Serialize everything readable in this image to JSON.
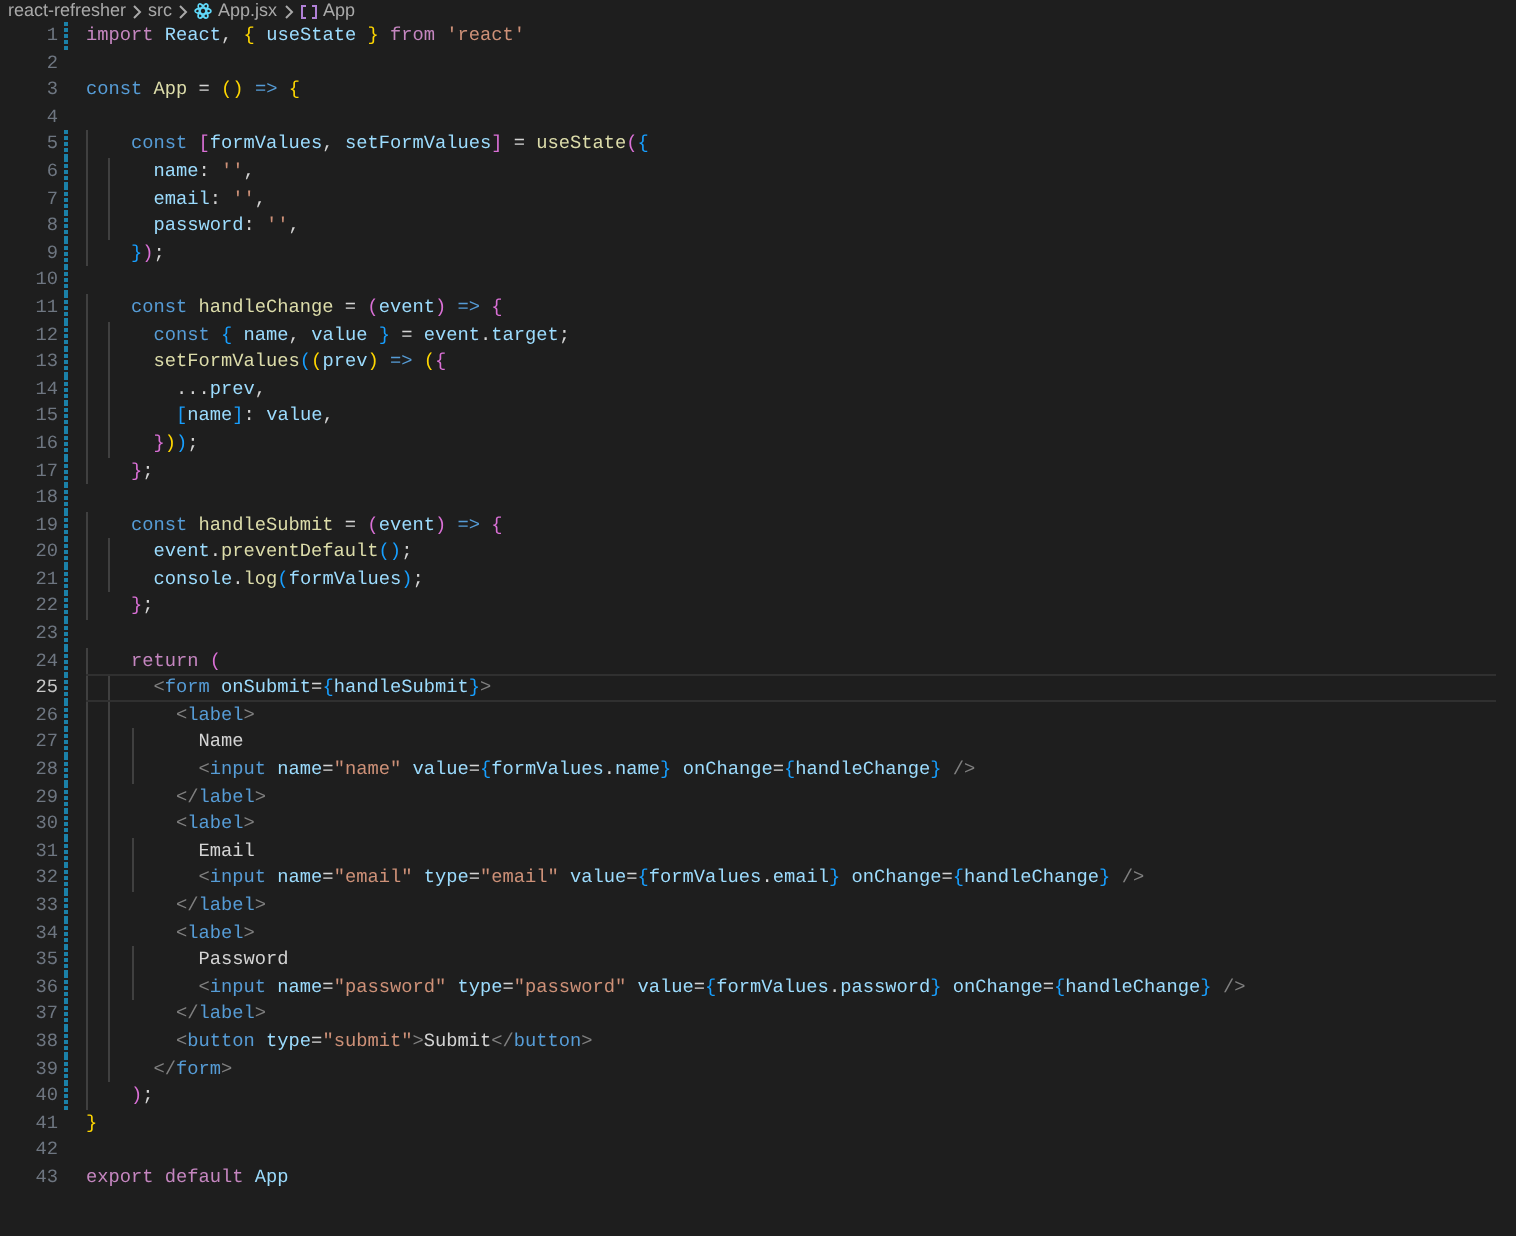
{
  "breadcrumb": [
    {
      "text": "react-refresher",
      "kind": "folder"
    },
    {
      "text": "src",
      "kind": "folder"
    },
    {
      "text": "App.jsx",
      "kind": "file"
    },
    {
      "text": "App",
      "kind": "symbol"
    }
  ],
  "editor": {
    "lines": [
      {
        "number": "1",
        "active": false,
        "modified": true,
        "tokens": [
          {
            "kind": "keyword",
            "text": "import"
          },
          {
            "kind": "variable",
            "text": " React"
          },
          {
            "kind": "punct",
            "text": ", "
          },
          {
            "kind": "bracket1",
            "text": "{"
          },
          {
            "kind": "variable",
            "text": " useState "
          },
          {
            "kind": "bracket1",
            "text": "}"
          },
          {
            "kind": "keyword",
            "text": " from"
          },
          {
            "kind": "string",
            "text": " 'react'"
          }
        ]
      },
      {
        "number": "2",
        "active": false,
        "modified": false
      },
      {
        "number": "3",
        "active": false,
        "modified": false,
        "tokens": [
          {
            "kind": "storage",
            "text": "const"
          },
          {
            "kind": "function",
            "text": " App"
          },
          {
            "kind": "punct",
            "text": " = "
          },
          {
            "kind": "bracket1",
            "text": "()"
          },
          {
            "kind": "storage",
            "text": " =>"
          },
          {
            "kind": "bracket1",
            "text": " {"
          }
        ]
      },
      {
        "number": "4",
        "active": false,
        "modified": false
      },
      {
        "number": "5",
        "active": false,
        "modified": true,
        "tokens": [
          {
            "kind": "storage",
            "text": "    const"
          },
          {
            "kind": "bracket2",
            "text": " ["
          },
          {
            "kind": "variable",
            "text": "formValues"
          },
          {
            "kind": "punct",
            "text": ", "
          },
          {
            "kind": "variable",
            "text": "setFormValues"
          },
          {
            "kind": "bracket2",
            "text": "]"
          },
          {
            "kind": "punct",
            "text": " = "
          },
          {
            "kind": "function",
            "text": "useState"
          },
          {
            "kind": "bracket2",
            "text": "("
          },
          {
            "kind": "bracket3",
            "text": "{"
          }
        ]
      },
      {
        "number": "6",
        "active": false,
        "modified": true,
        "tokens": [
          {
            "kind": "variable",
            "text": "      name"
          },
          {
            "kind": "punct",
            "text": ": "
          },
          {
            "kind": "string",
            "text": "''"
          },
          {
            "kind": "punct",
            "text": ","
          }
        ]
      },
      {
        "number": "7",
        "active": false,
        "modified": true,
        "tokens": [
          {
            "kind": "variable",
            "text": "      email"
          },
          {
            "kind": "punct",
            "text": ": "
          },
          {
            "kind": "string",
            "text": "''"
          },
          {
            "kind": "punct",
            "text": ","
          }
        ]
      },
      {
        "number": "8",
        "active": false,
        "modified": true,
        "tokens": [
          {
            "kind": "variable",
            "text": "      password"
          },
          {
            "kind": "punct",
            "text": ": "
          },
          {
            "kind": "string",
            "text": "''"
          },
          {
            "kind": "punct",
            "text": ","
          }
        ]
      },
      {
        "number": "9",
        "active": false,
        "modified": true,
        "tokens": [
          {
            "kind": "bracket3",
            "text": "    }"
          },
          {
            "kind": "bracket2",
            "text": ")"
          },
          {
            "kind": "punct",
            "text": ";"
          }
        ]
      },
      {
        "number": "10",
        "active": false,
        "modified": true
      },
      {
        "number": "11",
        "active": false,
        "modified": true,
        "tokens": [
          {
            "kind": "storage",
            "text": "    const"
          },
          {
            "kind": "function",
            "text": " handleChange"
          },
          {
            "kind": "punct",
            "text": " = "
          },
          {
            "kind": "bracket2",
            "text": "("
          },
          {
            "kind": "variable",
            "text": "event"
          },
          {
            "kind": "bracket2",
            "text": ")"
          },
          {
            "kind": "storage",
            "text": " =>"
          },
          {
            "kind": "bracket2",
            "text": " {"
          }
        ]
      },
      {
        "number": "12",
        "active": false,
        "modified": true,
        "tokens": [
          {
            "kind": "storage",
            "text": "      const"
          },
          {
            "kind": "bracket3",
            "text": " {"
          },
          {
            "kind": "variable",
            "text": " name"
          },
          {
            "kind": "punct",
            "text": ", "
          },
          {
            "kind": "variable",
            "text": "value "
          },
          {
            "kind": "bracket3",
            "text": "}"
          },
          {
            "kind": "punct",
            "text": " = "
          },
          {
            "kind": "variable",
            "text": "event"
          },
          {
            "kind": "punct",
            "text": "."
          },
          {
            "kind": "variable",
            "text": "target"
          },
          {
            "kind": "punct",
            "text": ";"
          }
        ]
      },
      {
        "number": "13",
        "active": false,
        "modified": true,
        "tokens": [
          {
            "kind": "function",
            "text": "      setFormValues"
          },
          {
            "kind": "bracket3",
            "text": "("
          },
          {
            "kind": "bracket1",
            "text": "("
          },
          {
            "kind": "variable",
            "text": "prev"
          },
          {
            "kind": "bracket1",
            "text": ")"
          },
          {
            "kind": "storage",
            "text": " =>"
          },
          {
            "kind": "bracket1",
            "text": " ("
          },
          {
            "kind": "bracket2",
            "text": "{"
          }
        ]
      },
      {
        "number": "14",
        "active": false,
        "modified": true,
        "tokens": [
          {
            "kind": "punct",
            "text": "        ..."
          },
          {
            "kind": "variable",
            "text": "prev"
          },
          {
            "kind": "punct",
            "text": ","
          }
        ]
      },
      {
        "number": "15",
        "active": false,
        "modified": true,
        "tokens": [
          {
            "kind": "bracket3",
            "text": "        ["
          },
          {
            "kind": "variable",
            "text": "name"
          },
          {
            "kind": "bracket3",
            "text": "]"
          },
          {
            "kind": "punct",
            "text": ": "
          },
          {
            "kind": "variable",
            "text": "value"
          },
          {
            "kind": "punct",
            "text": ","
          }
        ]
      },
      {
        "number": "16",
        "active": false,
        "modified": true,
        "tokens": [
          {
            "kind": "bracket2",
            "text": "      }"
          },
          {
            "kind": "bracket1",
            "text": ")"
          },
          {
            "kind": "bracket3",
            "text": ")"
          },
          {
            "kind": "punct",
            "text": ";"
          }
        ]
      },
      {
        "number": "17",
        "active": false,
        "modified": true,
        "tokens": [
          {
            "kind": "bracket2",
            "text": "    }"
          },
          {
            "kind": "punct",
            "text": ";"
          }
        ]
      },
      {
        "number": "18",
        "active": false,
        "modified": true
      },
      {
        "number": "19",
        "active": false,
        "modified": true,
        "tokens": [
          {
            "kind": "storage",
            "text": "    const"
          },
          {
            "kind": "function",
            "text": " handleSubmit"
          },
          {
            "kind": "punct",
            "text": " = "
          },
          {
            "kind": "bracket2",
            "text": "("
          },
          {
            "kind": "variable",
            "text": "event"
          },
          {
            "kind": "bracket2",
            "text": ")"
          },
          {
            "kind": "storage",
            "text": " =>"
          },
          {
            "kind": "bracket2",
            "text": " {"
          }
        ]
      },
      {
        "number": "20",
        "active": false,
        "modified": true,
        "tokens": [
          {
            "kind": "variable",
            "text": "      event"
          },
          {
            "kind": "punct",
            "text": "."
          },
          {
            "kind": "function",
            "text": "preventDefault"
          },
          {
            "kind": "bracket3",
            "text": "()"
          },
          {
            "kind": "punct",
            "text": ";"
          }
        ]
      },
      {
        "number": "21",
        "active": false,
        "modified": true,
        "tokens": [
          {
            "kind": "variable",
            "text": "      console"
          },
          {
            "kind": "punct",
            "text": "."
          },
          {
            "kind": "function",
            "text": "log"
          },
          {
            "kind": "bracket3",
            "text": "("
          },
          {
            "kind": "variable",
            "text": "formValues"
          },
          {
            "kind": "bracket3",
            "text": ")"
          },
          {
            "kind": "punct",
            "text": ";"
          }
        ]
      },
      {
        "number": "22",
        "active": false,
        "modified": true,
        "tokens": [
          {
            "kind": "bracket2",
            "text": "    }"
          },
          {
            "kind": "punct",
            "text": ";"
          }
        ]
      },
      {
        "number": "23",
        "active": false,
        "modified": true
      },
      {
        "number": "24",
        "active": false,
        "modified": true,
        "tokens": [
          {
            "kind": "keyword",
            "text": "    return"
          },
          {
            "kind": "bracket2",
            "text": " ("
          }
        ]
      },
      {
        "number": "25",
        "active": true,
        "modified": true,
        "tokens": [
          {
            "kind": "tagpunct",
            "text": "      <"
          },
          {
            "kind": "tag",
            "text": "form"
          },
          {
            "kind": "attribute",
            "text": " onSubmit"
          },
          {
            "kind": "punct",
            "text": "="
          },
          {
            "kind": "bracket3",
            "text": "{"
          },
          {
            "kind": "variable",
            "text": "handleSubmit"
          },
          {
            "kind": "bracket3",
            "text": "}"
          },
          {
            "kind": "tagpunct",
            "text": ">"
          }
        ]
      },
      {
        "number": "26",
        "active": false,
        "modified": true,
        "tokens": [
          {
            "kind": "tagpunct",
            "text": "        <"
          },
          {
            "kind": "tag",
            "text": "label"
          },
          {
            "kind": "tagpunct",
            "text": ">"
          }
        ]
      },
      {
        "number": "27",
        "active": false,
        "modified": true,
        "tokens": [
          {
            "kind": "text",
            "text": "          Name"
          }
        ]
      },
      {
        "number": "28",
        "active": false,
        "modified": true,
        "tokens": [
          {
            "kind": "tagpunct",
            "text": "          <"
          },
          {
            "kind": "tag",
            "text": "input"
          },
          {
            "kind": "attribute",
            "text": " name"
          },
          {
            "kind": "punct",
            "text": "="
          },
          {
            "kind": "string",
            "text": "\"name\""
          },
          {
            "kind": "attribute",
            "text": " value"
          },
          {
            "kind": "punct",
            "text": "="
          },
          {
            "kind": "bracket3",
            "text": "{"
          },
          {
            "kind": "variable",
            "text": "formValues"
          },
          {
            "kind": "punct",
            "text": "."
          },
          {
            "kind": "variable",
            "text": "name"
          },
          {
            "kind": "bracket3",
            "text": "}"
          },
          {
            "kind": "attribute",
            "text": " onChange"
          },
          {
            "kind": "punct",
            "text": "="
          },
          {
            "kind": "bracket3",
            "text": "{"
          },
          {
            "kind": "variable",
            "text": "handleChange"
          },
          {
            "kind": "bracket3",
            "text": "}"
          },
          {
            "kind": "tagpunct",
            "text": " />"
          }
        ]
      },
      {
        "number": "29",
        "active": false,
        "modified": true,
        "tokens": [
          {
            "kind": "tagpunct",
            "text": "        </"
          },
          {
            "kind": "tag",
            "text": "label"
          },
          {
            "kind": "tagpunct",
            "text": ">"
          }
        ]
      },
      {
        "number": "30",
        "active": false,
        "modified": true,
        "tokens": [
          {
            "kind": "tagpunct",
            "text": "        <"
          },
          {
            "kind": "tag",
            "text": "label"
          },
          {
            "kind": "tagpunct",
            "text": ">"
          }
        ]
      },
      {
        "number": "31",
        "active": false,
        "modified": true,
        "tokens": [
          {
            "kind": "text",
            "text": "          Email"
          }
        ]
      },
      {
        "number": "32",
        "active": false,
        "modified": true,
        "tokens": [
          {
            "kind": "tagpunct",
            "text": "          <"
          },
          {
            "kind": "tag",
            "text": "input"
          },
          {
            "kind": "attribute",
            "text": " name"
          },
          {
            "kind": "punct",
            "text": "="
          },
          {
            "kind": "string",
            "text": "\"email\""
          },
          {
            "kind": "attribute",
            "text": " type"
          },
          {
            "kind": "punct",
            "text": "="
          },
          {
            "kind": "string",
            "text": "\"email\""
          },
          {
            "kind": "attribute",
            "text": " value"
          },
          {
            "kind": "punct",
            "text": "="
          },
          {
            "kind": "bracket3",
            "text": "{"
          },
          {
            "kind": "variable",
            "text": "formValues"
          },
          {
            "kind": "punct",
            "text": "."
          },
          {
            "kind": "variable",
            "text": "email"
          },
          {
            "kind": "bracket3",
            "text": "}"
          },
          {
            "kind": "attribute",
            "text": " onChange"
          },
          {
            "kind": "punct",
            "text": "="
          },
          {
            "kind": "bracket3",
            "text": "{"
          },
          {
            "kind": "variable",
            "text": "handleChange"
          },
          {
            "kind": "bracket3",
            "text": "}"
          },
          {
            "kind": "tagpunct",
            "text": " />"
          }
        ]
      },
      {
        "number": "33",
        "active": false,
        "modified": true,
        "tokens": [
          {
            "kind": "tagpunct",
            "text": "        </"
          },
          {
            "kind": "tag",
            "text": "label"
          },
          {
            "kind": "tagpunct",
            "text": ">"
          }
        ]
      },
      {
        "number": "34",
        "active": false,
        "modified": true,
        "tokens": [
          {
            "kind": "tagpunct",
            "text": "        <"
          },
          {
            "kind": "tag",
            "text": "label"
          },
          {
            "kind": "tagpunct",
            "text": ">"
          }
        ]
      },
      {
        "number": "35",
        "active": false,
        "modified": true,
        "tokens": [
          {
            "kind": "text",
            "text": "          Password"
          }
        ]
      },
      {
        "number": "36",
        "active": false,
        "modified": true,
        "tokens": [
          {
            "kind": "tagpunct",
            "text": "          <"
          },
          {
            "kind": "tag",
            "text": "input"
          },
          {
            "kind": "attribute",
            "text": " name"
          },
          {
            "kind": "punct",
            "text": "="
          },
          {
            "kind": "string",
            "text": "\"password\""
          },
          {
            "kind": "attribute",
            "text": " type"
          },
          {
            "kind": "punct",
            "text": "="
          },
          {
            "kind": "string",
            "text": "\"password\""
          },
          {
            "kind": "attribute",
            "text": " value"
          },
          {
            "kind": "punct",
            "text": "="
          },
          {
            "kind": "bracket3",
            "text": "{"
          },
          {
            "kind": "variable",
            "text": "formValues"
          },
          {
            "kind": "punct",
            "text": "."
          },
          {
            "kind": "variable",
            "text": "password"
          },
          {
            "kind": "bracket3",
            "text": "}"
          },
          {
            "kind": "attribute",
            "text": " onChange"
          },
          {
            "kind": "punct",
            "text": "="
          },
          {
            "kind": "bracket3",
            "text": "{"
          },
          {
            "kind": "variable",
            "text": "handleChange"
          },
          {
            "kind": "bracket3",
            "text": "}"
          },
          {
            "kind": "tagpunct",
            "text": " />"
          }
        ]
      },
      {
        "number": "37",
        "active": false,
        "modified": true,
        "tokens": [
          {
            "kind": "tagpunct",
            "text": "        </"
          },
          {
            "kind": "tag",
            "text": "label"
          },
          {
            "kind": "tagpunct",
            "text": ">"
          }
        ]
      },
      {
        "number": "38",
        "active": false,
        "modified": true,
        "tokens": [
          {
            "kind": "tagpunct",
            "text": "        <"
          },
          {
            "kind": "tag",
            "text": "button"
          },
          {
            "kind": "attribute",
            "text": " type"
          },
          {
            "kind": "punct",
            "text": "="
          },
          {
            "kind": "string",
            "text": "\"submit\""
          },
          {
            "kind": "tagpunct",
            "text": ">"
          },
          {
            "kind": "text",
            "text": "Submit"
          },
          {
            "kind": "tagpunct",
            "text": "</"
          },
          {
            "kind": "tag",
            "text": "button"
          },
          {
            "kind": "tagpunct",
            "text": ">"
          }
        ]
      },
      {
        "number": "39",
        "active": false,
        "modified": true,
        "tokens": [
          {
            "kind": "tagpunct",
            "text": "      </"
          },
          {
            "kind": "tag",
            "text": "form"
          },
          {
            "kind": "tagpunct",
            "text": ">"
          }
        ]
      },
      {
        "number": "40",
        "active": false,
        "modified": true,
        "tokens": [
          {
            "kind": "bracket2",
            "text": "    )"
          },
          {
            "kind": "punct",
            "text": ";"
          }
        ]
      },
      {
        "number": "41",
        "active": false,
        "modified": false,
        "tokens": [
          {
            "kind": "bracket1",
            "text": "}"
          }
        ]
      },
      {
        "number": "42",
        "active": false,
        "modified": false
      },
      {
        "number": "43",
        "active": false,
        "modified": false,
        "tokens": [
          {
            "kind": "keyword",
            "text": "export"
          },
          {
            "kind": "keyword",
            "text": " default"
          },
          {
            "kind": "variable",
            "text": " App"
          }
        ]
      }
    ]
  }
}
